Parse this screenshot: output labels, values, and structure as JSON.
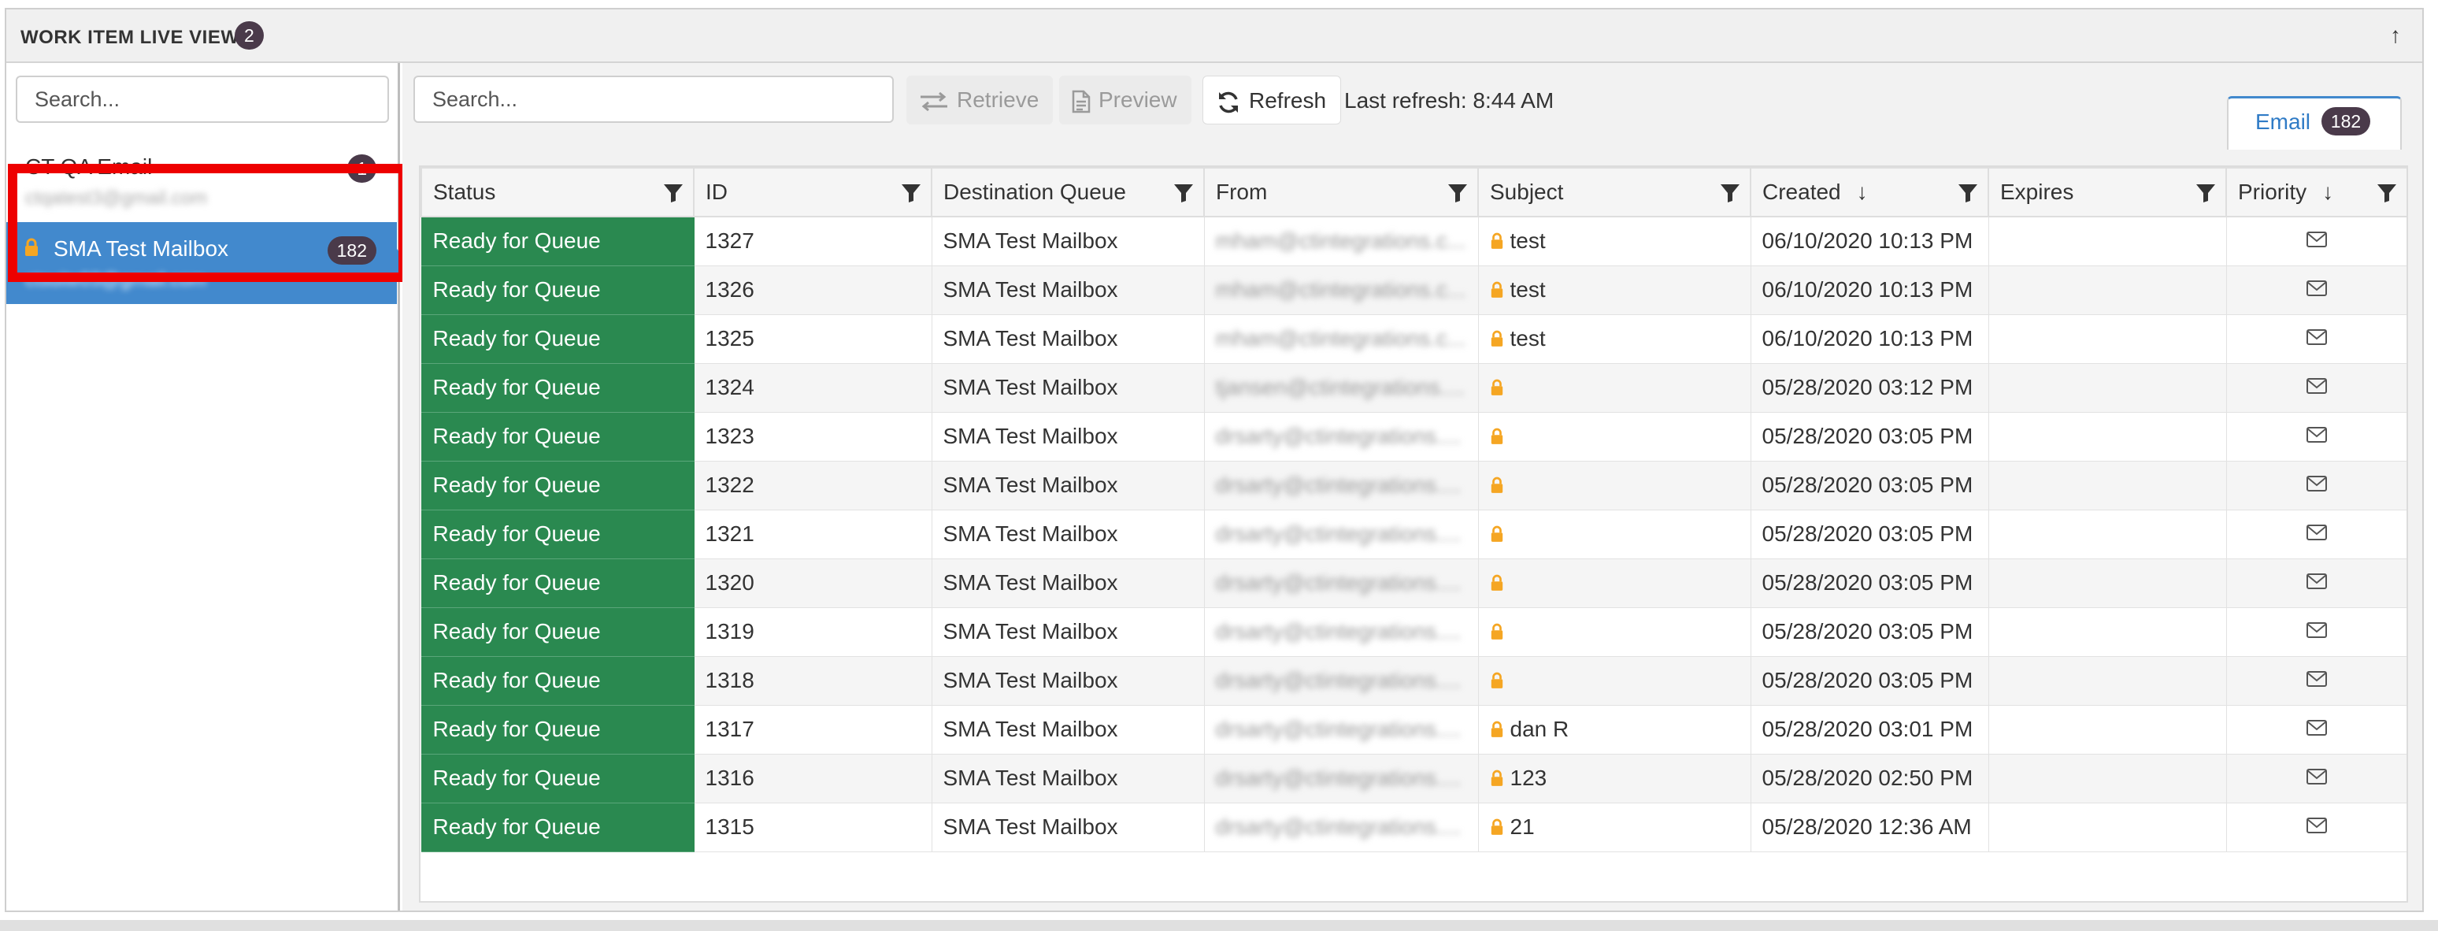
{
  "header": {
    "title": "WORK ITEM LIVE VIEW",
    "badge": "2"
  },
  "left": {
    "search_placeholder": "Search...",
    "mailboxes": [
      {
        "name": "CT QA Email",
        "email": "ctqatest3@gmail.com",
        "count": "1",
        "selected": false
      },
      {
        "name": "SMA Test Mailbox",
        "email": "ctsuite03@gmail.com",
        "count": "182",
        "selected": true
      }
    ]
  },
  "toolbar": {
    "search_placeholder": "Search...",
    "retrieve_label": "Retrieve",
    "preview_label": "Preview",
    "refresh_label": "Refresh",
    "last_refresh": "Last refresh: 8:44 AM"
  },
  "tab": {
    "label": "Email",
    "count": "182"
  },
  "columns": [
    "Status",
    "ID",
    "Destination Queue",
    "From",
    "Subject",
    "Created",
    "Expires",
    "Priority"
  ],
  "rows": [
    {
      "status": "Ready for Queue",
      "id": "1327",
      "queue": "SMA Test Mailbox",
      "from": "mham@ctintegrations.c...",
      "subject": "test",
      "created": "06/10/2020 10:13 PM",
      "expires": ""
    },
    {
      "status": "Ready for Queue",
      "id": "1326",
      "queue": "SMA Test Mailbox",
      "from": "mham@ctintegrations.c...",
      "subject": "test",
      "created": "06/10/2020 10:13 PM",
      "expires": ""
    },
    {
      "status": "Ready for Queue",
      "id": "1325",
      "queue": "SMA Test Mailbox",
      "from": "mham@ctintegrations.c...",
      "subject": "test",
      "created": "06/10/2020 10:13 PM",
      "expires": ""
    },
    {
      "status": "Ready for Queue",
      "id": "1324",
      "queue": "SMA Test Mailbox",
      "from": "tjansen@ctintegrations....",
      "subject": "",
      "created": "05/28/2020 03:12 PM",
      "expires": ""
    },
    {
      "status": "Ready for Queue",
      "id": "1323",
      "queue": "SMA Test Mailbox",
      "from": "drsarty@ctintegrations....",
      "subject": "",
      "created": "05/28/2020 03:05 PM",
      "expires": ""
    },
    {
      "status": "Ready for Queue",
      "id": "1322",
      "queue": "SMA Test Mailbox",
      "from": "drsarty@ctintegrations....",
      "subject": "",
      "created": "05/28/2020 03:05 PM",
      "expires": ""
    },
    {
      "status": "Ready for Queue",
      "id": "1321",
      "queue": "SMA Test Mailbox",
      "from": "drsarty@ctintegrations....",
      "subject": "",
      "created": "05/28/2020 03:05 PM",
      "expires": ""
    },
    {
      "status": "Ready for Queue",
      "id": "1320",
      "queue": "SMA Test Mailbox",
      "from": "drsarty@ctintegrations....",
      "subject": "",
      "created": "05/28/2020 03:05 PM",
      "expires": ""
    },
    {
      "status": "Ready for Queue",
      "id": "1319",
      "queue": "SMA Test Mailbox",
      "from": "drsarty@ctintegrations....",
      "subject": "",
      "created": "05/28/2020 03:05 PM",
      "expires": ""
    },
    {
      "status": "Ready for Queue",
      "id": "1318",
      "queue": "SMA Test Mailbox",
      "from": "drsarty@ctintegrations....",
      "subject": "",
      "created": "05/28/2020 03:05 PM",
      "expires": ""
    },
    {
      "status": "Ready for Queue",
      "id": "1317",
      "queue": "SMA Test Mailbox",
      "from": "drsarty@ctintegrations....",
      "subject": "dan R",
      "created": "05/28/2020 03:01 PM",
      "expires": ""
    },
    {
      "status": "Ready for Queue",
      "id": "1316",
      "queue": "SMA Test Mailbox",
      "from": "drsarty@ctintegrations....",
      "subject": "123",
      "created": "05/28/2020 02:50 PM",
      "expires": ""
    },
    {
      "status": "Ready for Queue",
      "id": "1315",
      "queue": "SMA Test Mailbox",
      "from": "drsarty@ctintegrations....",
      "subject": "21",
      "created": "05/28/2020 12:36 AM",
      "expires": ""
    }
  ],
  "colors": {
    "status_green": "#2a8950",
    "selected_blue": "#4289cd",
    "lock_orange": "#f5a623",
    "highlight_red": "#ee0000"
  },
  "icons": {
    "priority": "envelope-icon",
    "subject_lock": "lock-icon",
    "column_filter": "filter-icon"
  }
}
